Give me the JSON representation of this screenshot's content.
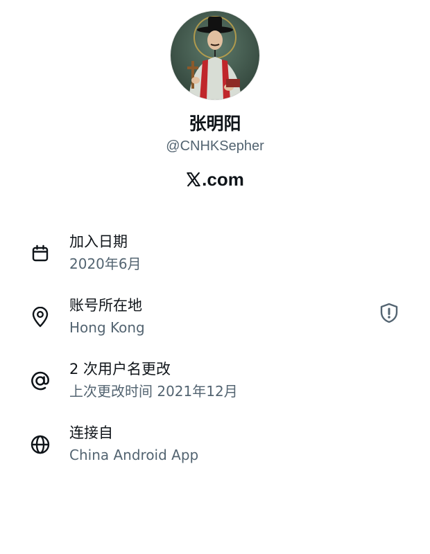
{
  "profile": {
    "display_name": "张明阳",
    "handle": "@CNHKSepher",
    "site": ".com",
    "avatar_icon": "profile-avatar"
  },
  "rows": [
    {
      "icon": "calendar-icon",
      "title": "加入日期",
      "subtitle": "2020年6月"
    },
    {
      "icon": "location-pin-icon",
      "title": "账号所在地",
      "subtitle": "Hong Kong",
      "trailing_icon": "shield-alert-icon"
    },
    {
      "icon": "at-sign-icon",
      "title": "2 次用户名更改",
      "subtitle": "上次更改时间 2021年12月"
    },
    {
      "icon": "globe-icon",
      "title": "连接自",
      "subtitle": "China Android App"
    }
  ],
  "colors": {
    "primary_text": "#0f1419",
    "secondary_text": "#536471"
  }
}
